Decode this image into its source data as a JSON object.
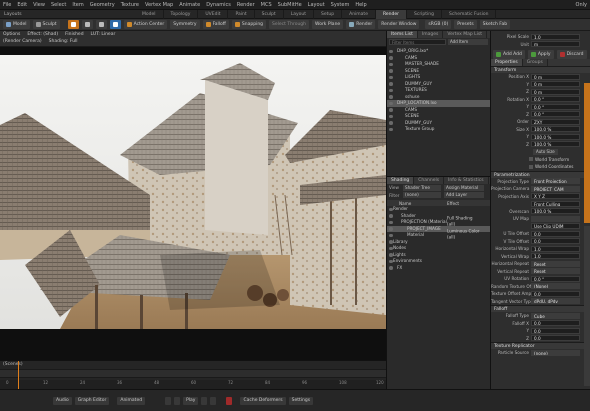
{
  "menu": [
    "File",
    "Edit",
    "View",
    "Select",
    "Item",
    "Geometry",
    "Texture",
    "Vertex Map",
    "Animate",
    "Dynamics",
    "Render",
    "MCS",
    "SubMitHe",
    "Layout",
    "System",
    "Help"
  ],
  "menu_right": "Only",
  "layout_label": "Layouts",
  "layout_tabs": [
    {
      "label": "Model",
      "on": false
    },
    {
      "label": "Topology",
      "on": false
    },
    {
      "label": "UVEdit",
      "on": false
    },
    {
      "label": "Paint",
      "on": false
    },
    {
      "label": "Sculpt",
      "on": false
    },
    {
      "label": "Layout",
      "on": false
    },
    {
      "label": "Setup",
      "on": false
    },
    {
      "label": "Animate",
      "on": false
    },
    {
      "label": "Render",
      "on": true
    },
    {
      "label": "Scripting",
      "on": false
    },
    {
      "label": "Schematic Fusion",
      "on": false
    }
  ],
  "toolbar": {
    "model": "Model",
    "sculpt": "Sculpt",
    "action_center": "Action Center",
    "symmetry": "Symmetry",
    "falloff": "Falloff",
    "snapping": "Snapping",
    "select_through": "Select Through",
    "work_plane": "Work Plane",
    "render": "Render",
    "render_window": "Render Window",
    "preset": "sRGB (0)",
    "presets_menu": "Presets",
    "sketch": "Sketch Fab"
  },
  "viewport": {
    "line1": [
      "Options",
      "Effect: (Shad)",
      "Finished",
      "LUT: Linear"
    ],
    "line2": [
      "(Render Camera)",
      "Shading: Full"
    ]
  },
  "timeline": {
    "label": "(Scenes)",
    "ticks": [
      "0",
      "12",
      "24",
      "36",
      "48",
      "60",
      "72",
      "84",
      "96",
      "108",
      "120"
    ]
  },
  "bottombar": {
    "audio": "Audio",
    "graph_editor": "Graph Editor",
    "animated": "Animated",
    "play": "Play",
    "cache": "Cache Deformers",
    "settings": "Settings"
  },
  "outliner": {
    "tabs": [
      {
        "label": "Items List",
        "on": true
      },
      {
        "label": "Images",
        "on": false
      },
      {
        "label": "Vertex Map List",
        "on": false
      }
    ],
    "filter": "Filter Items",
    "add_item": "Add Item",
    "items": [
      {
        "label": "DHP_ORIG.lxo*",
        "indent": 10,
        "sel": false
      },
      {
        "label": "CAMS",
        "indent": 18,
        "sel": false
      },
      {
        "label": "MASTER_SHADE",
        "indent": 18,
        "sel": false
      },
      {
        "label": "SCENE",
        "indent": 18,
        "sel": false
      },
      {
        "label": "LIGHTS",
        "indent": 18,
        "sel": false
      },
      {
        "label": "DUMMY_GUY",
        "indent": 18,
        "sel": false
      },
      {
        "label": "TEXTURES",
        "indent": 18,
        "sel": false
      },
      {
        "label": "sshuse",
        "indent": 18,
        "sel": false
      },
      {
        "label": "DHP_LOCATION.lxo",
        "indent": 10,
        "sel": true
      },
      {
        "label": "CAMS",
        "indent": 18,
        "sel": false
      },
      {
        "label": "SCENE",
        "indent": 18,
        "sel": false
      },
      {
        "label": "DUMMY_GUY",
        "indent": 18,
        "sel": false
      },
      {
        "label": "Texture Group",
        "indent": 18,
        "sel": false
      }
    ]
  },
  "shader": {
    "tabs": [
      {
        "label": "Shading",
        "on": true
      },
      {
        "label": "Channels",
        "on": false
      },
      {
        "label": "Info & Statistics",
        "on": false
      }
    ],
    "view_label": "View",
    "view_value": "Shader Tree",
    "assign": "Assign Material",
    "filter_label": "Filter",
    "filter_value": "(none)",
    "add_layer": "Add Layer",
    "col_name": "Name",
    "col_effect": "Effect",
    "rows": [
      {
        "label": "Render",
        "effect": "",
        "indent": 6,
        "sel": false
      },
      {
        "label": "Shader",
        "effect": "Full Shading",
        "indent": 14,
        "sel": false
      },
      {
        "label": "PROJECTION (Material)",
        "effect": "(all)",
        "indent": 14,
        "sel": false
      },
      {
        "label": "PROJECT_IMAGE",
        "effect": "Luminous Color",
        "indent": 20,
        "sel": true
      },
      {
        "label": "Material",
        "effect": "(all)",
        "indent": 20,
        "sel": false
      },
      {
        "label": "Library",
        "effect": "",
        "indent": 6,
        "sel": false
      },
      {
        "label": "Nodes",
        "effect": "",
        "indent": 6,
        "sel": false
      },
      {
        "label": "Lights",
        "effect": "",
        "indent": 6,
        "sel": false
      },
      {
        "label": "Environments",
        "effect": "",
        "indent": 6,
        "sel": false
      },
      {
        "label": "FX",
        "effect": "",
        "indent": 10,
        "sel": false
      }
    ]
  },
  "props": {
    "top": [
      {
        "label": "Pixel Scale",
        "value": "1.0"
      },
      {
        "label": "Unit",
        "value": "m"
      }
    ],
    "buttons": {
      "add": "Add Add",
      "apply": "Apply",
      "discard": "Discard"
    },
    "tabs": [
      {
        "label": "Properties",
        "on": true
      },
      {
        "label": "Groups",
        "on": false
      }
    ],
    "transform_title": "Transform",
    "transform": [
      {
        "label": "Position X",
        "value": "0 m"
      },
      {
        "label": "Y",
        "value": "0 m"
      },
      {
        "label": "Z",
        "value": "0 m"
      },
      {
        "label": "Rotation X",
        "value": "0.0 °"
      },
      {
        "label": "Y",
        "value": "0.0 °"
      },
      {
        "label": "Z",
        "value": "0.0 °"
      },
      {
        "label": "Order",
        "value": "ZXY"
      },
      {
        "label": "Size X",
        "value": "100.0 %"
      },
      {
        "label": "Y",
        "value": "100.0 %"
      },
      {
        "label": "Z",
        "value": "100.0 %"
      }
    ],
    "auto_size": "Auto Size",
    "world_transform": "World Transform",
    "world_coords": "World Coordinates",
    "param_title": "Parametrization",
    "params": [
      {
        "label": "Projection Type",
        "value": "Front Projection",
        "dd": true
      },
      {
        "label": "Projection Camera",
        "value": "PROJECT_CAM",
        "dd": true
      },
      {
        "label": "Projection Axis",
        "value": "X  Y  Z",
        "dd": false
      },
      {
        "label": "",
        "value": "Front Culling",
        "dd": false
      },
      {
        "label": "Overscan",
        "value": "100.0 %",
        "dd": false
      },
      {
        "label": "UV Map",
        "value": "",
        "dd": true
      },
      {
        "label": "",
        "value": "Use Clip UDIM",
        "dd": false
      },
      {
        "label": "U Tile Offset",
        "value": "0.0",
        "dd": false
      },
      {
        "label": "V Tile Offset",
        "value": "0.0",
        "dd": false
      },
      {
        "label": "Horizontal Wrap",
        "value": "1.0",
        "dd": false
      },
      {
        "label": "Vertical Wrap",
        "value": "1.0",
        "dd": false
      },
      {
        "label": "Horizontal Repeat",
        "value": "Reset",
        "dd": true
      },
      {
        "label": "Vertical Repeat",
        "value": "Reset",
        "dd": true
      },
      {
        "label": "UV Rotation",
        "value": "0.0 °",
        "dd": false
      },
      {
        "label": "Random Texture Offset",
        "value": "(None)",
        "dd": true
      },
      {
        "label": "Texture Offset Amp.",
        "value": "0.0",
        "dd": false
      },
      {
        "label": "Tangent Vector Type",
        "value": "dPdU, dPdv",
        "dd": true
      }
    ],
    "falloff_title": "Falloff",
    "falloff": [
      {
        "label": "Falloff Type",
        "value": "Cube",
        "dd": true
      },
      {
        "label": "Falloff X",
        "value": "0.0",
        "dd": false
      },
      {
        "label": "Y",
        "value": "0.0",
        "dd": false
      },
      {
        "label": "Z",
        "value": "0.0",
        "dd": false
      }
    ],
    "replicator_title": "Texture Replicator",
    "replicator": [
      {
        "label": "Particle Source",
        "value": "(none)",
        "dd": true
      }
    ]
  }
}
